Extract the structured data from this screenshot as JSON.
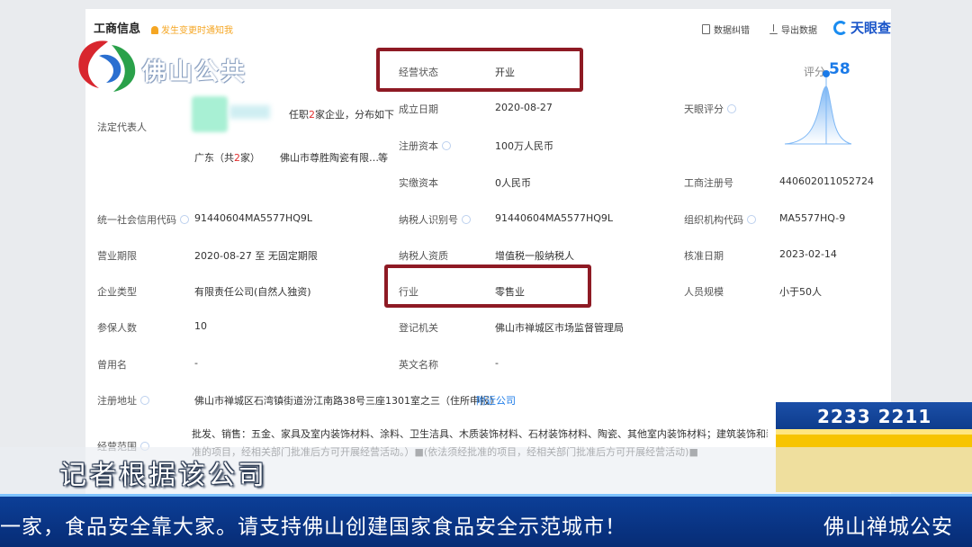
{
  "header": {
    "title": "工商信息",
    "notify": "发生变更时通知我",
    "btn_feedback": "数据纠错",
    "btn_export": "导出数据",
    "brand": "天眼查"
  },
  "channel_logo": "佛山公共",
  "rows": {
    "legal_rep": {
      "label": "法定代表人",
      "text1": "任职",
      "num": "2",
      "text2": "家企业，分布如下",
      "region": "广东（共",
      "region_num": "2",
      "region_end": "家）",
      "company": "佛山市尊胜陶瓷有限…",
      "etc": "等"
    },
    "status": {
      "label": "经营状态",
      "value": "开业"
    },
    "founded": {
      "label": "成立日期",
      "value": "2020-08-27"
    },
    "capital": {
      "label": "注册资本",
      "value": "100万人民币"
    },
    "paid": {
      "label": "实缴资本",
      "value": "0人民币"
    },
    "score": {
      "label": "天眼评分",
      "score_label": "评分",
      "score_value": "58"
    },
    "reg_no": {
      "label": "工商注册号",
      "value": "440602011052724"
    },
    "credit": {
      "label": "统一社会信用代码",
      "value": "91440604MA5577HQ9L"
    },
    "taxpayer_id": {
      "label": "纳税人识别号",
      "value": "91440604MA5577HQ9L"
    },
    "org_code": {
      "label": "组织机构代码",
      "value": "MA5577HQ-9"
    },
    "period": {
      "label": "营业期限",
      "value": "2020-08-27 至 无固定期限"
    },
    "tax_qual": {
      "label": "纳税人资质",
      "value": "增值税一般纳税人"
    },
    "approve": {
      "label": "核准日期",
      "value": "2023-02-14"
    },
    "type": {
      "label": "企业类型",
      "value": "有限责任公司(自然人独资)"
    },
    "industry": {
      "label": "行业",
      "value": "零售业"
    },
    "staff": {
      "label": "人员规模",
      "value": "小于50人"
    },
    "insured": {
      "label": "参保人数",
      "value": "10"
    },
    "authority": {
      "label": "登记机关",
      "value": "佛山市禅城区市场监督管理局"
    },
    "former": {
      "label": "曾用名",
      "value": "-"
    },
    "english": {
      "label": "英文名称",
      "value": "-"
    },
    "address": {
      "label": "注册地址",
      "value": "佛山市禅城区石湾镇街道汾江南路38号三座1301室之三（住所申报）",
      "link": "附近公司"
    },
    "scope": {
      "label": "经营范围",
      "line1": "批发、销售：五金、家具及室内装饰材料、涂料、卫生洁具、木质装饰材料、石材装饰材料、陶瓷、其他室内装饰材料；建筑装饰和装修业；工程",
      "line2": "准的项目，经相关部门批准后方可开展经营活动。）■(依法须经批准的项目，经相关部门批准后方可开展经营活动)■"
    }
  },
  "hotline": "2233 2211",
  "subtitle": "记者根据该公司",
  "ticker": {
    "main": "一家，食品安全靠大家。请支持佛山创建国家食品安全示范城市！",
    "right": "佛山禅城公安"
  },
  "colors": {
    "highlight_box": "#8e1a24",
    "link": "#1a7ae8",
    "ticker_bg": "#0c3f98",
    "hotline": "#f7c400"
  }
}
